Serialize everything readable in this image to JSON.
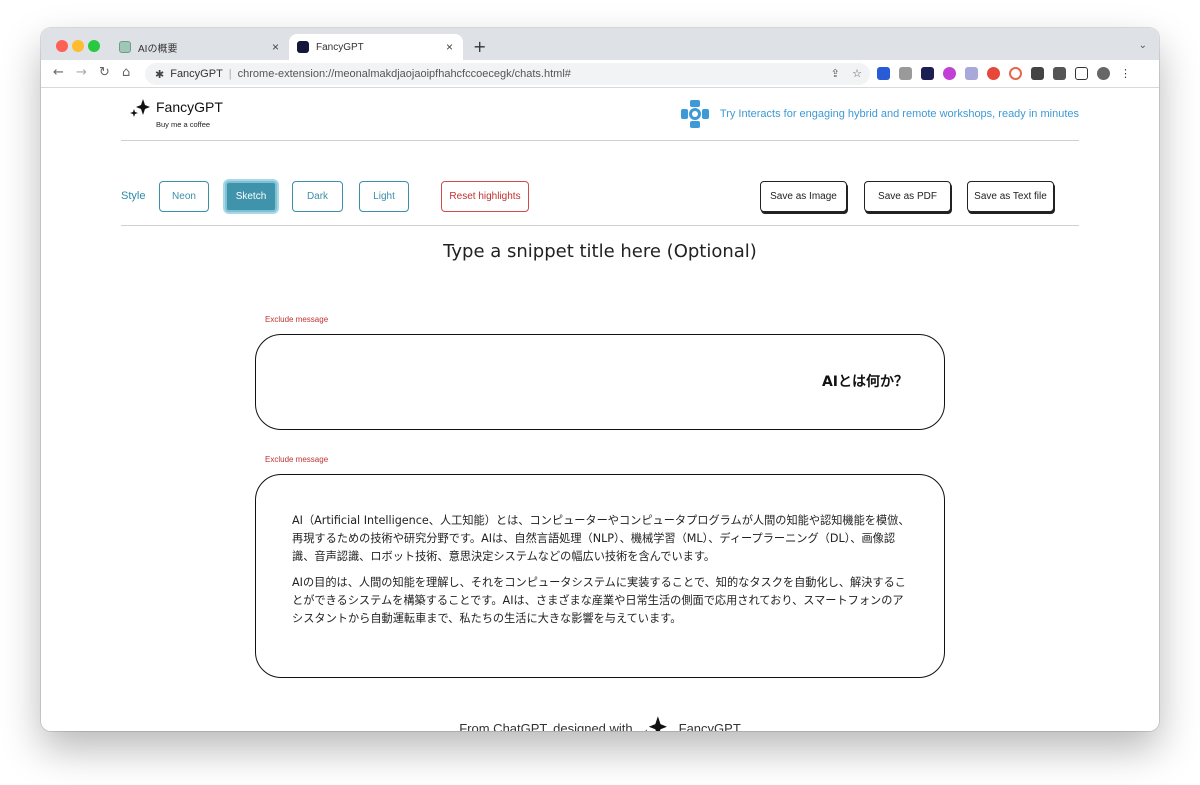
{
  "browser": {
    "tabs": [
      {
        "title": "AIの概要",
        "active": false
      },
      {
        "title": "FancyGPT",
        "active": true
      }
    ],
    "close_glyph": "×",
    "new_tab_glyph": "+",
    "tab_list_glyph": "⌄",
    "nav": {
      "back": "←",
      "forward": "→",
      "reload": "↻",
      "home": "⌂"
    },
    "omnibox": {
      "site_name": "FancyGPT",
      "separator": "|",
      "url": "chrome-extension://meonalmakdjaojaoipfhahcfccoecegk/chats.html#",
      "share_glyph": "⇪",
      "bookmark_glyph": "☆"
    },
    "extension_colors": [
      "#2a5bd7",
      "#9a9a9a",
      "#1c1f52",
      "#c23fd6",
      "#a9a9d9",
      "#e5483b",
      "#e8664a",
      "#444444",
      "#555555",
      "#666666"
    ]
  },
  "app": {
    "logo_title": "FancyGPT",
    "logo_subtitle": "Buy me a coffee",
    "promo_text": "Try Interacts for engaging hybrid and remote workshops, ready in minutes",
    "style_label": "Style",
    "style_buttons": {
      "neon": "Neon",
      "sketch": "Sketch",
      "dark": "Dark",
      "light": "Light"
    },
    "reset_label": "Reset highlights",
    "save_buttons": {
      "image": "Save as Image",
      "pdf": "Save as PDF",
      "text": "Save as Text file"
    },
    "snippet_title": "Type a snippet title here (Optional)",
    "messages": [
      {
        "exclude_label": "Exclude message",
        "text": "AIとは何か？"
      },
      {
        "exclude_label": "Exclude message",
        "paragraphs": [
          "AI（Artificial Intelligence、人工知能）とは、コンピューターやコンピュータプログラムが人間の知能や認知機能を模倣、再現するための技術や研究分野です。AIは、自然言語処理（NLP）、機械学習（ML）、ディープラーニング（DL）、画像認識、音声認識、ロボット技術、意思決定システムなどの幅広い技術を含んでいます。",
          "AIの目的は、人間の知能を理解し、それをコンピュータシステムに実装することで、知的なタスクを自動化し、解決することができるシステムを構築することです。AIは、さまざまな産業や日常生活の側面で応用されており、スマートフォンのアシスタントから自動運転車まで、私たちの生活に大きな影響を与えています。"
        ]
      }
    ],
    "footer": {
      "prefix": "From ChatGPT, designed with",
      "brand": "FancyGPT"
    },
    "colors": {
      "accent": "#3f93ab",
      "reset": "#c23030",
      "promo": "#3d9ad6"
    }
  }
}
